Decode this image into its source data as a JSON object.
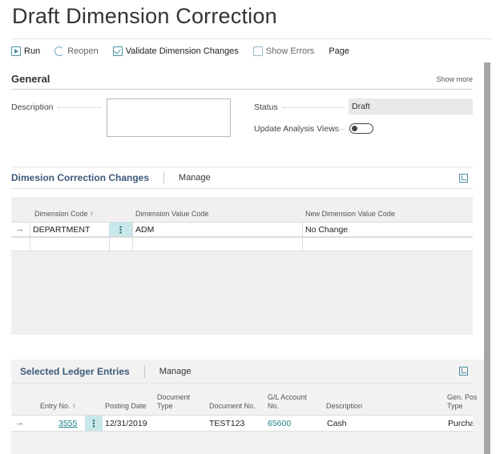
{
  "page": {
    "title": "Draft Dimension Correction"
  },
  "actions": {
    "run": "Run",
    "reopen": "Reopen",
    "validate": "Validate Dimension Changes",
    "show_errors": "Show Errors",
    "page": "Page"
  },
  "general": {
    "header": "General",
    "show_more": "Show more",
    "description_label": "Description",
    "description_value": "",
    "status_label": "Status",
    "status_value": "Draft",
    "update_analysis_label": "Update Analysis Views",
    "update_analysis_value": false
  },
  "changes": {
    "title": "Dimesion Correction Changes",
    "manage": "Manage",
    "columns": [
      "Dimension Code ↑",
      "Dimension Value Code",
      "New Dimension Value Code"
    ],
    "rows": [
      {
        "dimension_code": "DEPARTMENT",
        "dimension_value_code": "ADM",
        "new_dimension_value_code": "No Change"
      }
    ]
  },
  "ledger": {
    "title": "Selected Ledger Entries",
    "manage": "Manage",
    "columns": {
      "entry_no": "Entry No. ↑",
      "posting_date": "Posting Date",
      "document_type_1": "Document",
      "document_type_2": "Type",
      "document_no": "Document No.",
      "gl_account_1": "G/L Account",
      "gl_account_2": "No.",
      "description": "Description",
      "gen_posting_1": "Gen. Pos",
      "gen_posting_2": "Type"
    },
    "rows": [
      {
        "entry_no": "3555",
        "posting_date": "12/31/2019",
        "document_type": "",
        "document_no": "TEST123",
        "gl_account_no": "65600",
        "description": "Cash",
        "gen_posting_type": "Purcha"
      }
    ]
  },
  "colors": {
    "accent": "#1a7f86",
    "kebab_bg": "#c8e8ea",
    "section_title": "#3c5a78"
  }
}
